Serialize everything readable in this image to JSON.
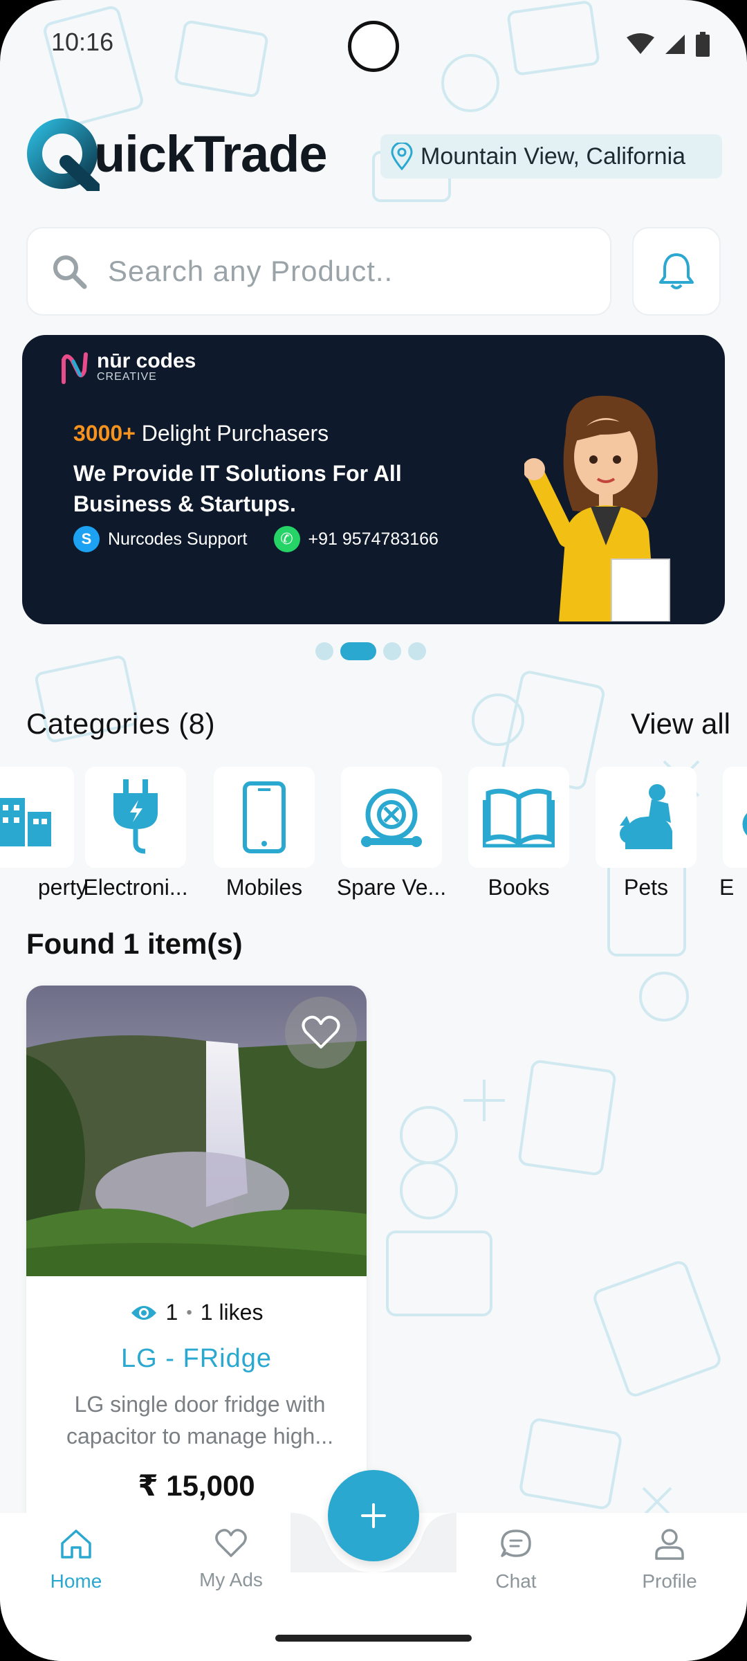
{
  "status_bar": {
    "time": "10:16"
  },
  "header": {
    "app_name": "uickTrade",
    "location": "Mountain View, California"
  },
  "search": {
    "placeholder": "Search any Product.."
  },
  "banner": {
    "brand_name": "nūr codes",
    "brand_sub": "CREATIVE",
    "stat_highlight": "3000+",
    "stat_text": " Delight Purchasers",
    "headline": "We Provide IT Solutions For All Business & Startups.",
    "contact_1": "Nurcodes Support",
    "contact_2": "+91 9574783166",
    "slide_count": 4,
    "active_slide": 2
  },
  "categories": {
    "title": "Categories (8)",
    "view_all": "View all",
    "items": [
      {
        "label": "perty",
        "icon": "building-icon"
      },
      {
        "label": "Electroni...",
        "icon": "plug-icon"
      },
      {
        "label": "Mobiles",
        "icon": "phone-icon"
      },
      {
        "label": "Spare Ve...",
        "icon": "spare-part-icon"
      },
      {
        "label": "Books",
        "icon": "book-icon"
      },
      {
        "label": "Pets",
        "icon": "pets-icon"
      },
      {
        "label": "E",
        "icon": "scooter-icon"
      }
    ]
  },
  "results": {
    "title": "Found 1 item(s)"
  },
  "product": {
    "views": "1",
    "likes": "1 likes",
    "title": "LG - FRidge",
    "description": "LG single door fridge with capacitor to manage high...",
    "price": "₹ 15,000"
  },
  "nav": {
    "home": "Home",
    "my_ads": "My Ads",
    "chat": "Chat",
    "profile": "Profile"
  },
  "colors": {
    "accent": "#2aa8d0",
    "banner_bg": "#0e1a2b",
    "orange": "#f6921e"
  }
}
